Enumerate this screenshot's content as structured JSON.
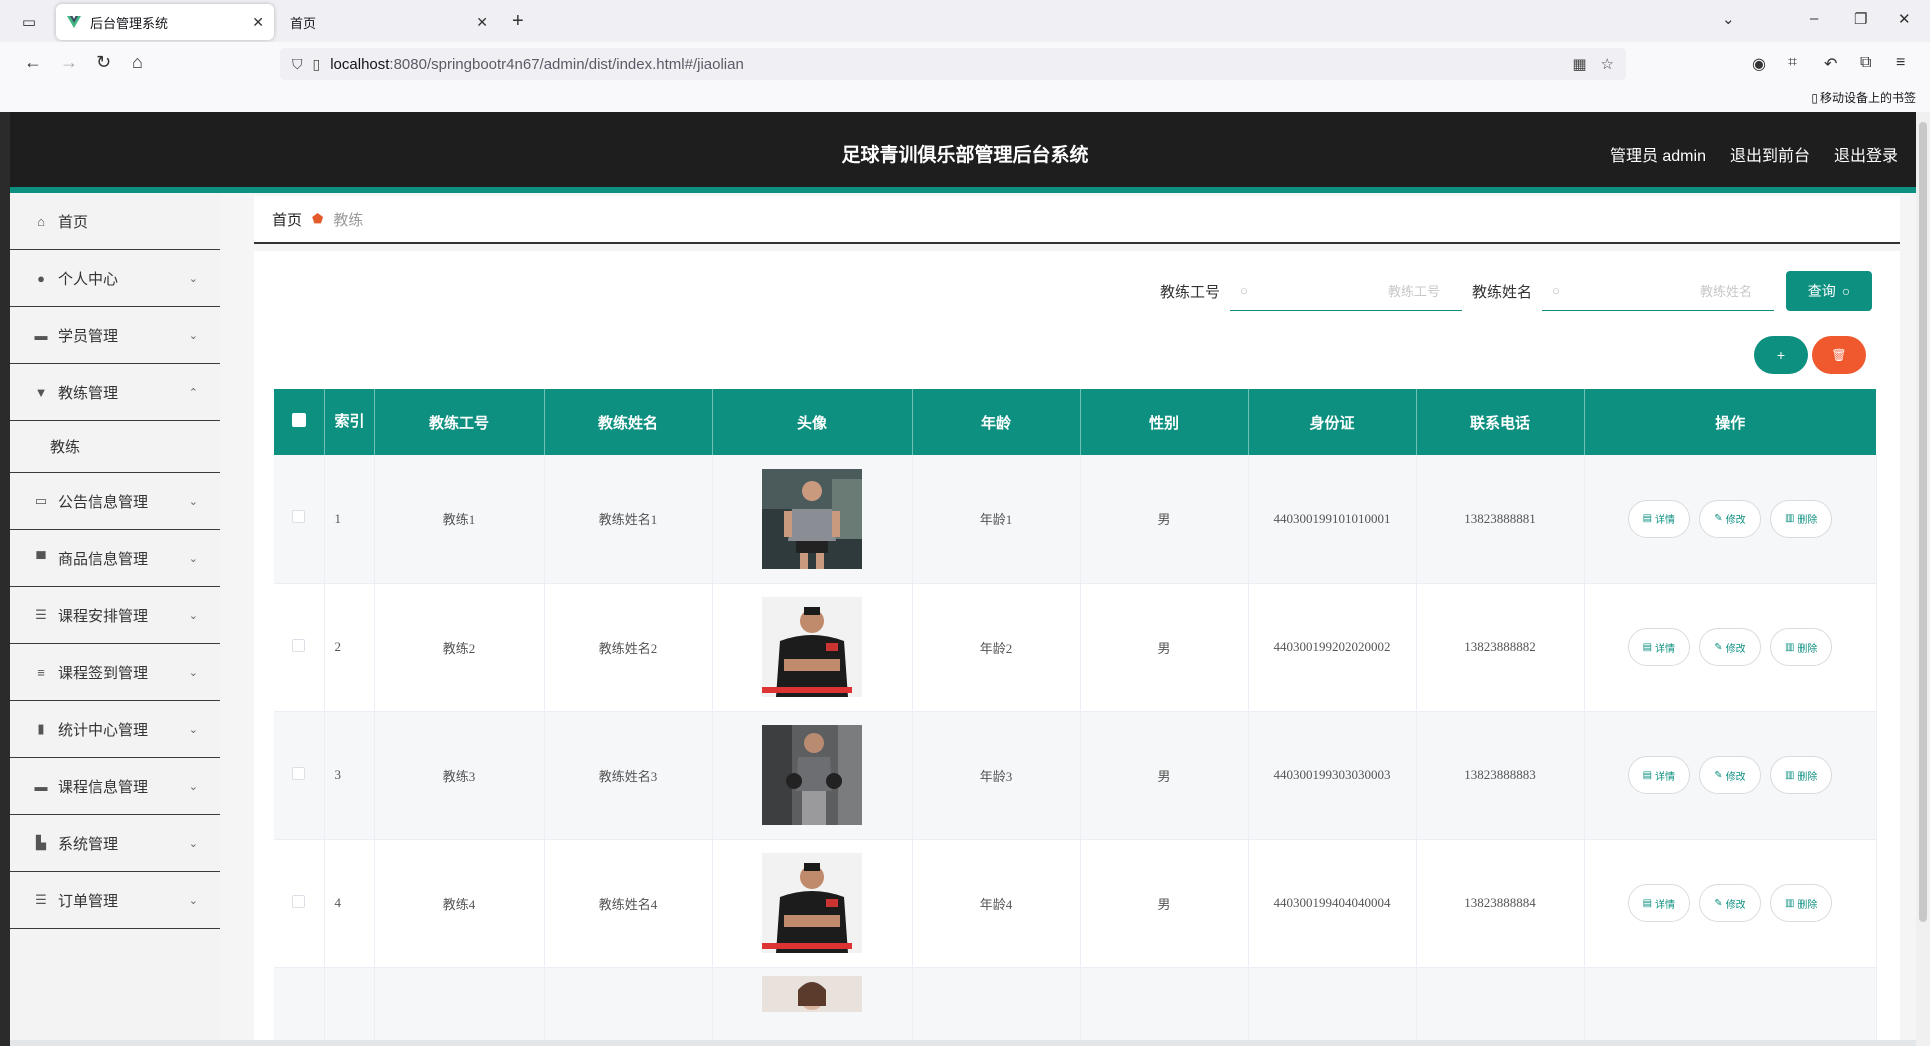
{
  "browser": {
    "tabs": [
      {
        "title": "后台管理系统",
        "active": true
      },
      {
        "title": "首页",
        "active": false
      }
    ],
    "url_host": "localhost",
    "url_rest": ":8080/springbootr4n67/admin/dist/index.html#/jiaolian",
    "bookmark": "移动设备上的书签"
  },
  "app": {
    "title": "足球青训俱乐部管理后台系统",
    "header_links": [
      "管理员 admin",
      "退出到前台",
      "退出登录"
    ],
    "accent_color": "#0e9081",
    "danger_color": "#f0582d"
  },
  "sidebar": {
    "items": [
      {
        "label": "首页",
        "icon": "home-icon",
        "expandable": false
      },
      {
        "label": "个人中心",
        "icon": "user-icon",
        "expandable": true
      },
      {
        "label": "学员管理",
        "icon": "briefcase-icon",
        "expandable": true
      },
      {
        "label": "教练管理",
        "icon": "podium-icon",
        "expandable": true,
        "expanded": true,
        "children": [
          "教练"
        ]
      },
      {
        "label": "公告信息管理",
        "icon": "ticket-icon",
        "expandable": true
      },
      {
        "label": "商品信息管理",
        "icon": "monitor-icon",
        "expandable": true
      },
      {
        "label": "课程安排管理",
        "icon": "sliders-icon",
        "expandable": true
      },
      {
        "label": "课程签到管理",
        "icon": "list-icon",
        "expandable": true
      },
      {
        "label": "统计中心管理",
        "icon": "bar-chart-icon",
        "expandable": true
      },
      {
        "label": "课程信息管理",
        "icon": "chat-icon",
        "expandable": true
      },
      {
        "label": "系统管理",
        "icon": "factory-icon",
        "expandable": true
      },
      {
        "label": "订单管理",
        "icon": "menu-icon",
        "expandable": true
      }
    ]
  },
  "breadcrumb": {
    "home": "首页",
    "current": "教练"
  },
  "search": {
    "fields": [
      {
        "label": "教练工号",
        "placeholder": "教练工号"
      },
      {
        "label": "教练姓名",
        "placeholder": "教练姓名"
      }
    ],
    "query_label": "查询"
  },
  "actions": {
    "add_label": "+",
    "delete_label": "🗑"
  },
  "table": {
    "columns": [
      "索引",
      "教练工号",
      "教练姓名",
      "头像",
      "年龄",
      "性别",
      "身份证",
      "联系电话",
      "操作"
    ],
    "ops": [
      "详情",
      "修改",
      "删除"
    ],
    "rows": [
      {
        "index": "1",
        "no": "教练1",
        "name": "教练姓名1",
        "age": "年龄1",
        "gender": "男",
        "id_card": "440300199101010001",
        "phone": "13823888881"
      },
      {
        "index": "2",
        "no": "教练2",
        "name": "教练姓名2",
        "age": "年龄2",
        "gender": "男",
        "id_card": "440300199202020002",
        "phone": "13823888882"
      },
      {
        "index": "3",
        "no": "教练3",
        "name": "教练姓名3",
        "age": "年龄3",
        "gender": "男",
        "id_card": "440300199303030003",
        "phone": "13823888883"
      },
      {
        "index": "4",
        "no": "教练4",
        "name": "教练姓名4",
        "age": "年龄4",
        "gender": "男",
        "id_card": "440300199404040004",
        "phone": "13823888884"
      },
      {
        "index": "",
        "no": "",
        "name": "",
        "age": "",
        "gender": "",
        "id_card": "",
        "phone": ""
      }
    ]
  }
}
